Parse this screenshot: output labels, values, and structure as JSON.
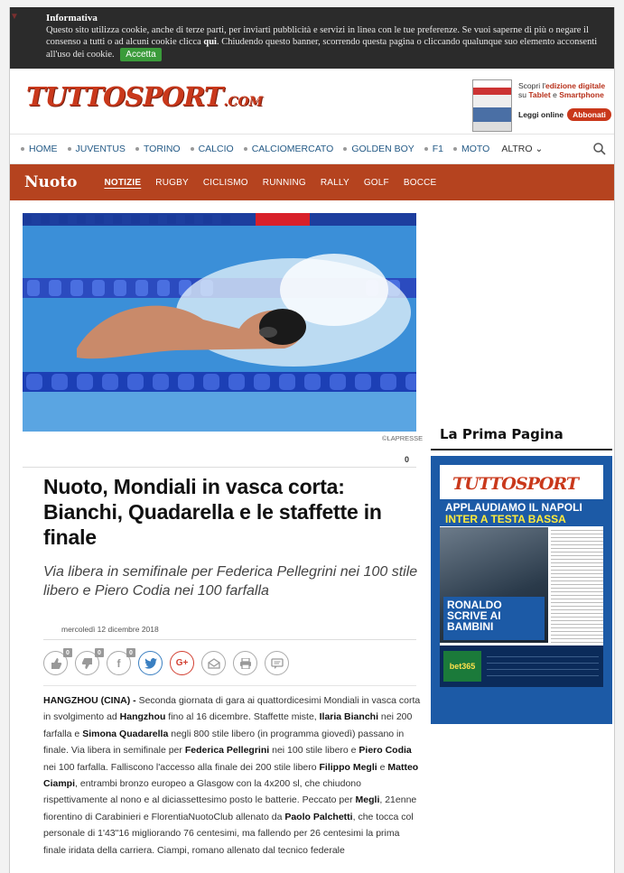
{
  "cookie": {
    "title": "Informativa",
    "text1": "Questo sito utilizza cookie, anche di terze parti, per inviarti pubblicità e servizi in linea con le tue preferenze. Se vuoi saperne di più o negare il consenso a tutti o ad alcuni cookie clicca ",
    "qui": "qui",
    "text2": ". Chiudendo questo banner, scorrendo questa pagina o cliccando qualunque suo elemento acconsenti all'uso dei cookie.",
    "accept": "Accetta"
  },
  "header": {
    "logo_main": "TUTTOSPORT",
    "logo_suffix": ".COM",
    "promo_pre": "Scopri l'",
    "promo_bold": "edizione digitale",
    "promo_mid": " su ",
    "promo_tablet": "Tablet",
    "promo_e": " e ",
    "promo_smart": "Smartphone",
    "leggi": "Leggi online",
    "abbonati": "Abbonati"
  },
  "mainnav": {
    "items": [
      "HOME",
      "JUVENTUS",
      "TORINO",
      "CALCIO",
      "CALCIOMERCATO",
      "GOLDEN BOY",
      "F1",
      "MOTO"
    ],
    "altro": "ALTRO ⌄"
  },
  "secnav": {
    "section": "Nuoto",
    "items": [
      "NOTIZIE",
      "RUGBY",
      "CICLISMO",
      "RUNNING",
      "RALLY",
      "GOLF",
      "BOCCE"
    ]
  },
  "article": {
    "credit": "©LAPRESSE",
    "comment_count": "0",
    "title": "Nuoto, Mondiali in vasca corta: Bianchi, Quadarella e le staffette in finale",
    "subtitle": "Via libera in semifinale per Federica Pellegrini nei 100 stile libero e Piero Codia nei 100 farfalla",
    "date": "mercoledì 12 dicembre 2018",
    "social": {
      "like_count": "0",
      "dislike_count": "0",
      "fb_count": "0",
      "fb": "f",
      "gplus": "G+"
    }
  },
  "sidebar": {
    "title": "La Prima Pagina",
    "cover": {
      "logo": "TUTTOSPORT",
      "headline_top": "APPLAUDIAMO IL NAPOLI",
      "headline_top2": "INTER A TESTA BASSA",
      "headline_main": "RONALDO SCRIVE AI BAMBINI",
      "bet": "bet365"
    }
  },
  "colors": {
    "brand_red": "#c9381b",
    "section_bar": "#b5431f",
    "nav_link": "#245a86",
    "cover_blue": "#1c5aa6"
  }
}
